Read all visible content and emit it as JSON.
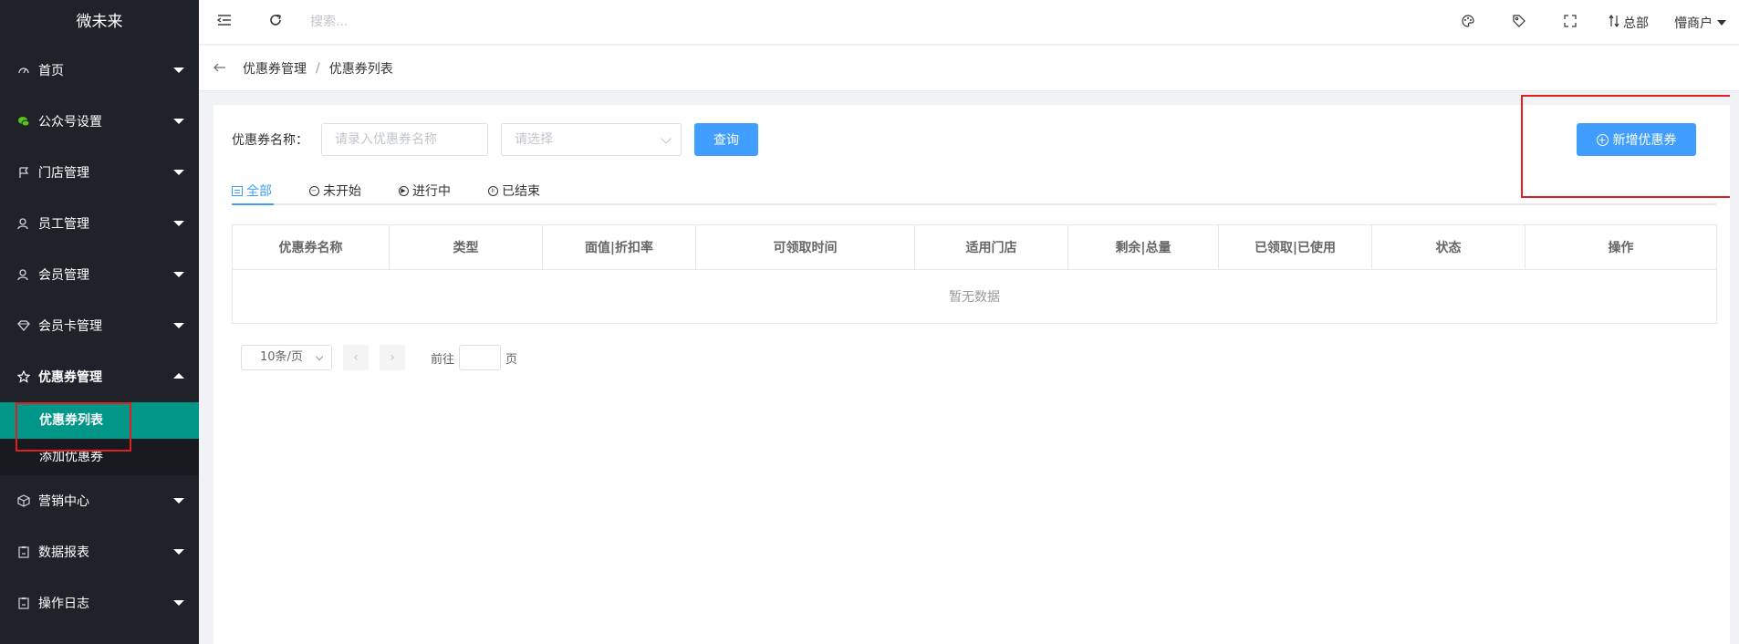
{
  "sidebar": {
    "logo": "微未来",
    "items": [
      {
        "label": "首页",
        "icon": "gauge-icon"
      },
      {
        "label": "公众号设置",
        "icon": "wechat-icon"
      },
      {
        "label": "门店管理",
        "icon": "flag-icon"
      },
      {
        "label": "员工管理",
        "icon": "user-icon"
      },
      {
        "label": "会员管理",
        "icon": "user-icon"
      },
      {
        "label": "会员卡管理",
        "icon": "diamond-icon"
      },
      {
        "label": "优惠券管理",
        "icon": "star-icon"
      },
      {
        "label": "营销中心",
        "icon": "cube-icon"
      },
      {
        "label": "数据报表",
        "icon": "clipboard-icon"
      },
      {
        "label": "操作日志",
        "icon": "clipboard-icon"
      }
    ],
    "submenu": [
      {
        "label": "优惠券列表",
        "active": true
      },
      {
        "label": "添加优惠券",
        "active": false
      }
    ]
  },
  "header": {
    "search_placeholder": "搜索...",
    "branch_label": "总部",
    "user_label": "懵商户"
  },
  "breadcrumb": {
    "parent": "优惠券管理",
    "separator": "/",
    "current": "优惠券列表"
  },
  "filters": {
    "name_label": "优惠券名称：",
    "name_placeholder": "请录入优惠券名称",
    "select_placeholder": "请选择",
    "query_label": "查询",
    "add_label": "新增优惠券"
  },
  "tabs": [
    {
      "label": "全部",
      "active": true
    },
    {
      "label": "未开始",
      "active": false
    },
    {
      "label": "进行中",
      "active": false
    },
    {
      "label": "已结束",
      "active": false
    }
  ],
  "table": {
    "columns": [
      "优惠券名称",
      "类型",
      "面值|折扣率",
      "可领取时间",
      "适用门店",
      "剩余|总量",
      "已领取|已使用",
      "状态",
      "操作"
    ],
    "empty_text": "暂无数据"
  },
  "pagination": {
    "page_size": "10条/页",
    "goto_label": "前往",
    "goto_suffix": "页"
  },
  "colors": {
    "sidebar_bg": "#20222a",
    "active_menu": "#009688",
    "primary": "#409eff",
    "highlight_box": "#e02020"
  }
}
